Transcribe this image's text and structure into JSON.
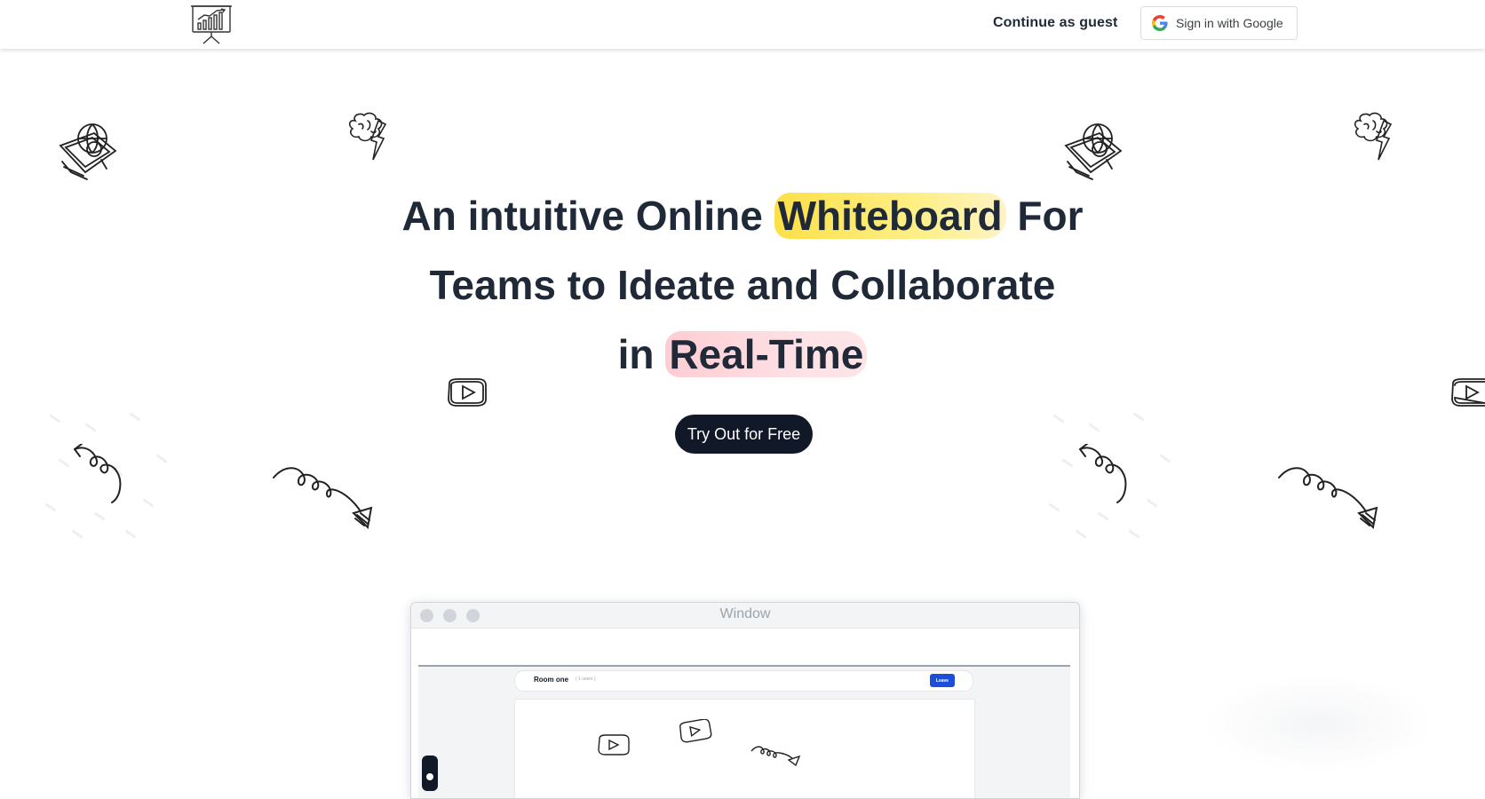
{
  "header": {
    "logo_icon": "presentation-chart-icon",
    "guest_label": "Continue as guest",
    "google_label": "Sign in with Google",
    "google_icon": "google-g-icon"
  },
  "hero": {
    "line1_pre": "An intuitive Online ",
    "line1_highlight": "Whiteboard",
    "line1_post": " For",
    "line2": "Teams to Ideate and Collaborate",
    "line3_pre": "in ",
    "line3_highlight": "Real-Time",
    "cta_label": "Try Out for Free"
  },
  "decorations": [
    "computer-globe-icon",
    "brain-lightning-icon",
    "play-button-icon",
    "curly-arrow-icon"
  ],
  "window": {
    "title": "Window",
    "room_name": "Room one",
    "room_users": "( 1 users )",
    "leave_label": "Leave"
  },
  "colors": {
    "cta_bg": "#111827",
    "highlight_yellow": "#fde047",
    "highlight_pink": "#fecdd3",
    "leave_blue": "#1d4ed8"
  }
}
